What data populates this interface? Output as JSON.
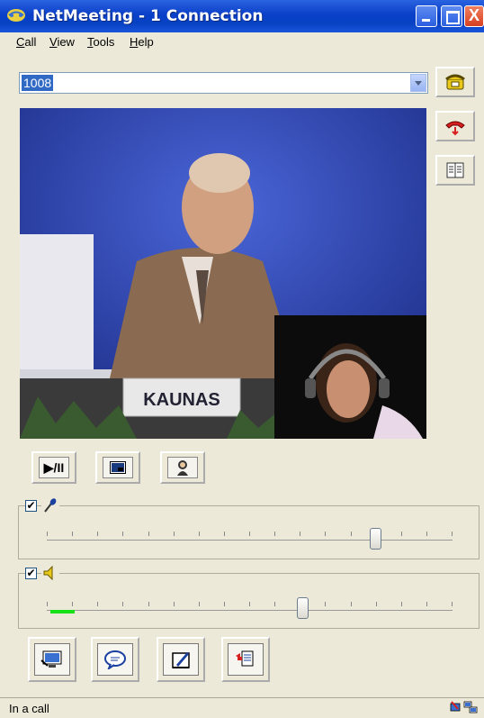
{
  "window": {
    "title": "NetMeeting - 1 Connection",
    "controls": {
      "minimize": "minimize",
      "maximize": "maximize",
      "close": "X"
    }
  },
  "menu": {
    "items": [
      {
        "label": "Call",
        "underline": "C",
        "rest": "all"
      },
      {
        "label": "View",
        "underline": "V",
        "rest": "iew"
      },
      {
        "label": "Tools",
        "underline": "T",
        "rest": "ools"
      },
      {
        "label": "Help",
        "underline": "H",
        "rest": "elp"
      }
    ]
  },
  "address": {
    "value": "1008"
  },
  "side_buttons": [
    {
      "name": "place-call",
      "icon": "phone-dial-icon"
    },
    {
      "name": "end-call",
      "icon": "hang-up-icon"
    },
    {
      "name": "directory",
      "icon": "address-book-icon"
    }
  ],
  "video": {
    "nameplate": "KAUNAS"
  },
  "video_controls": [
    {
      "name": "play-pause",
      "label": "▶/II"
    },
    {
      "name": "picture-in-picture",
      "icon": "pip-icon"
    },
    {
      "name": "adjust-audio",
      "icon": "person-icon"
    }
  ],
  "microphone": {
    "enabled": true,
    "level": 0.81
  },
  "speaker": {
    "enabled": true,
    "level": 0.63,
    "activity": 0.06
  },
  "bottom_buttons": [
    {
      "name": "share-program",
      "icon": "share-icon"
    },
    {
      "name": "chat",
      "icon": "chat-icon"
    },
    {
      "name": "whiteboard",
      "icon": "whiteboard-icon"
    },
    {
      "name": "file-transfer",
      "icon": "file-transfer-icon"
    }
  ],
  "status": {
    "text": "In a call"
  },
  "colors": {
    "titlebar": "#0a3fc8",
    "level": "#18e018",
    "selection": "#316ac5"
  }
}
